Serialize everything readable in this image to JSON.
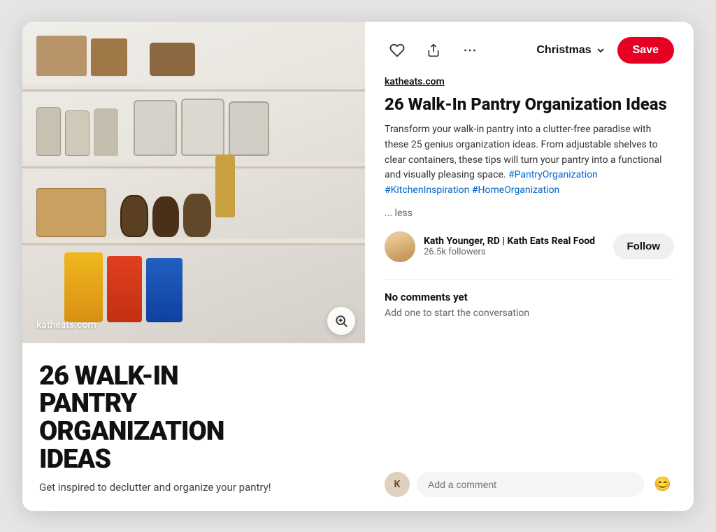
{
  "modal": {
    "left": {
      "watermark": "katheats.com",
      "lens_label": "Search with lens",
      "title_big_line1": "26 WALK-IN",
      "title_big_line2": "PANTRY",
      "title_big_line3": "ORGANIZATION",
      "title_big_line4": "IDEAS",
      "subtitle": "Get inspired to declutter and organize your pantry!"
    },
    "right": {
      "toolbar": {
        "like_label": "Like",
        "share_label": "Share",
        "more_label": "More options",
        "board_name": "Christmas",
        "chevron_label": "dropdown",
        "save_label": "Save"
      },
      "source": "katheats.com",
      "title": "26 Walk-In Pantry Organization Ideas",
      "description": "Transform your walk-in pantry into a clutter-free paradise with these 25 genius organization ideas. From adjustable shelves to clear containers, these tips will turn your pantry into a functional and visually pleasing space.",
      "hashtags": "#PantryOrganization #KitchenInspiration #HomeOrganization",
      "less_link": "... less",
      "author": {
        "name": "Kath Younger, RD | Kath Eats Real Food",
        "followers": "26.5k followers",
        "follow_label": "Follow"
      },
      "comments": {
        "empty_label": "No comments yet",
        "cta": "Add one to start the conversation",
        "input_placeholder": "Add a comment",
        "commenter_initial": "K"
      }
    }
  }
}
